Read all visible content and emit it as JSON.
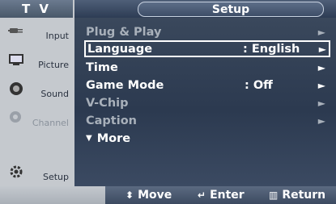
{
  "header": {
    "tv_label": "T V",
    "title": "Setup"
  },
  "sidebar": {
    "items": [
      {
        "label": "Input",
        "icon": "input-plug-icon"
      },
      {
        "label": "Picture",
        "icon": "picture-monitor-icon"
      },
      {
        "label": "Sound",
        "icon": "speaker-icon"
      },
      {
        "label": "Channel",
        "icon": "satellite-dish-icon"
      },
      {
        "label": "Setup",
        "icon": "gear-icon"
      }
    ]
  },
  "menu": {
    "items": [
      {
        "label": "Plug & Play",
        "value": "",
        "state": "disabled"
      },
      {
        "label": "Language",
        "value": ": English",
        "state": "selected"
      },
      {
        "label": "Time",
        "value": "",
        "state": "normal"
      },
      {
        "label": "Game Mode",
        "value": ": Off",
        "state": "normal"
      },
      {
        "label": "V-Chip",
        "value": "",
        "state": "disabled"
      },
      {
        "label": "Caption",
        "value": "",
        "state": "disabled"
      }
    ],
    "more_label": "More"
  },
  "footer": {
    "move": "Move",
    "enter": "Enter",
    "return": "Return"
  },
  "colors": {
    "menu_bg": "#2c3a50",
    "sidebar_bg": "#c5c9ce",
    "highlight_border": "#ffffff"
  }
}
